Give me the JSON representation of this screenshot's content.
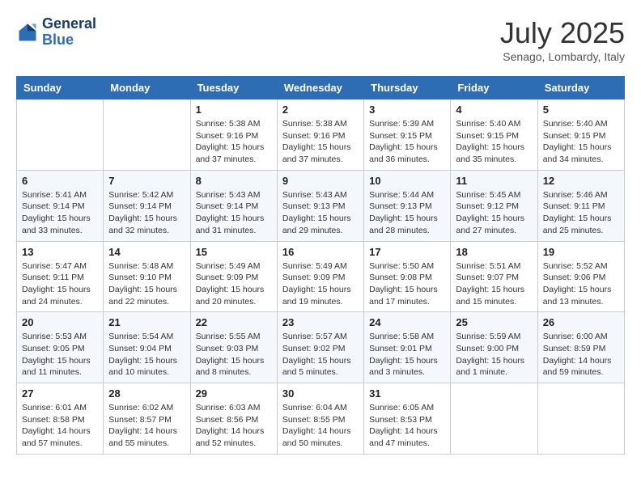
{
  "logo": {
    "line1": "General",
    "line2": "Blue"
  },
  "title": "July 2025",
  "location": "Senago, Lombardy, Italy",
  "headers": [
    "Sunday",
    "Monday",
    "Tuesday",
    "Wednesday",
    "Thursday",
    "Friday",
    "Saturday"
  ],
  "weeks": [
    [
      {
        "day": "",
        "info": ""
      },
      {
        "day": "",
        "info": ""
      },
      {
        "day": "1",
        "info": "Sunrise: 5:38 AM\nSunset: 9:16 PM\nDaylight: 15 hours and 37 minutes."
      },
      {
        "day": "2",
        "info": "Sunrise: 5:38 AM\nSunset: 9:16 PM\nDaylight: 15 hours and 37 minutes."
      },
      {
        "day": "3",
        "info": "Sunrise: 5:39 AM\nSunset: 9:15 PM\nDaylight: 15 hours and 36 minutes."
      },
      {
        "day": "4",
        "info": "Sunrise: 5:40 AM\nSunset: 9:15 PM\nDaylight: 15 hours and 35 minutes."
      },
      {
        "day": "5",
        "info": "Sunrise: 5:40 AM\nSunset: 9:15 PM\nDaylight: 15 hours and 34 minutes."
      }
    ],
    [
      {
        "day": "6",
        "info": "Sunrise: 5:41 AM\nSunset: 9:14 PM\nDaylight: 15 hours and 33 minutes."
      },
      {
        "day": "7",
        "info": "Sunrise: 5:42 AM\nSunset: 9:14 PM\nDaylight: 15 hours and 32 minutes."
      },
      {
        "day": "8",
        "info": "Sunrise: 5:43 AM\nSunset: 9:14 PM\nDaylight: 15 hours and 31 minutes."
      },
      {
        "day": "9",
        "info": "Sunrise: 5:43 AM\nSunset: 9:13 PM\nDaylight: 15 hours and 29 minutes."
      },
      {
        "day": "10",
        "info": "Sunrise: 5:44 AM\nSunset: 9:13 PM\nDaylight: 15 hours and 28 minutes."
      },
      {
        "day": "11",
        "info": "Sunrise: 5:45 AM\nSunset: 9:12 PM\nDaylight: 15 hours and 27 minutes."
      },
      {
        "day": "12",
        "info": "Sunrise: 5:46 AM\nSunset: 9:11 PM\nDaylight: 15 hours and 25 minutes."
      }
    ],
    [
      {
        "day": "13",
        "info": "Sunrise: 5:47 AM\nSunset: 9:11 PM\nDaylight: 15 hours and 24 minutes."
      },
      {
        "day": "14",
        "info": "Sunrise: 5:48 AM\nSunset: 9:10 PM\nDaylight: 15 hours and 22 minutes."
      },
      {
        "day": "15",
        "info": "Sunrise: 5:49 AM\nSunset: 9:09 PM\nDaylight: 15 hours and 20 minutes."
      },
      {
        "day": "16",
        "info": "Sunrise: 5:49 AM\nSunset: 9:09 PM\nDaylight: 15 hours and 19 minutes."
      },
      {
        "day": "17",
        "info": "Sunrise: 5:50 AM\nSunset: 9:08 PM\nDaylight: 15 hours and 17 minutes."
      },
      {
        "day": "18",
        "info": "Sunrise: 5:51 AM\nSunset: 9:07 PM\nDaylight: 15 hours and 15 minutes."
      },
      {
        "day": "19",
        "info": "Sunrise: 5:52 AM\nSunset: 9:06 PM\nDaylight: 15 hours and 13 minutes."
      }
    ],
    [
      {
        "day": "20",
        "info": "Sunrise: 5:53 AM\nSunset: 9:05 PM\nDaylight: 15 hours and 11 minutes."
      },
      {
        "day": "21",
        "info": "Sunrise: 5:54 AM\nSunset: 9:04 PM\nDaylight: 15 hours and 10 minutes."
      },
      {
        "day": "22",
        "info": "Sunrise: 5:55 AM\nSunset: 9:03 PM\nDaylight: 15 hours and 8 minutes."
      },
      {
        "day": "23",
        "info": "Sunrise: 5:57 AM\nSunset: 9:02 PM\nDaylight: 15 hours and 5 minutes."
      },
      {
        "day": "24",
        "info": "Sunrise: 5:58 AM\nSunset: 9:01 PM\nDaylight: 15 hours and 3 minutes."
      },
      {
        "day": "25",
        "info": "Sunrise: 5:59 AM\nSunset: 9:00 PM\nDaylight: 15 hours and 1 minute."
      },
      {
        "day": "26",
        "info": "Sunrise: 6:00 AM\nSunset: 8:59 PM\nDaylight: 14 hours and 59 minutes."
      }
    ],
    [
      {
        "day": "27",
        "info": "Sunrise: 6:01 AM\nSunset: 8:58 PM\nDaylight: 14 hours and 57 minutes."
      },
      {
        "day": "28",
        "info": "Sunrise: 6:02 AM\nSunset: 8:57 PM\nDaylight: 14 hours and 55 minutes."
      },
      {
        "day": "29",
        "info": "Sunrise: 6:03 AM\nSunset: 8:56 PM\nDaylight: 14 hours and 52 minutes."
      },
      {
        "day": "30",
        "info": "Sunrise: 6:04 AM\nSunset: 8:55 PM\nDaylight: 14 hours and 50 minutes."
      },
      {
        "day": "31",
        "info": "Sunrise: 6:05 AM\nSunset: 8:53 PM\nDaylight: 14 hours and 47 minutes."
      },
      {
        "day": "",
        "info": ""
      },
      {
        "day": "",
        "info": ""
      }
    ]
  ]
}
